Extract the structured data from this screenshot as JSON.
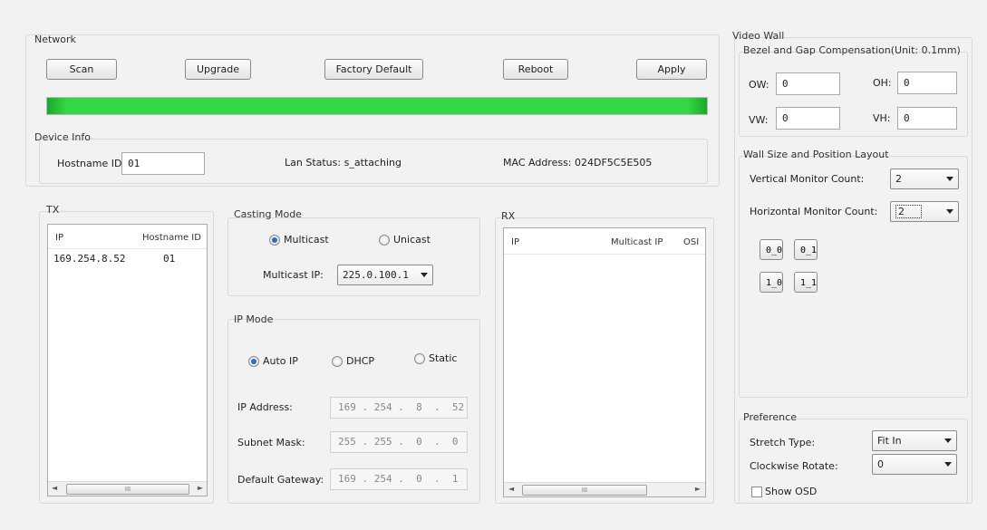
{
  "network": {
    "title": "Network",
    "buttons": {
      "scan": "Scan",
      "upgrade": "Upgrade",
      "factory_default": "Factory Default",
      "reboot": "Reboot",
      "apply": "Apply"
    },
    "progress_fraction": 1.0,
    "progress_color": "#2fcc3d"
  },
  "device_info": {
    "title": "Device Info",
    "hostname_label": "Hostname ID:",
    "hostname_value": "01",
    "lan_status": "Lan Status: s_attaching",
    "mac_address": "MAC Address: 024DF5C5E505"
  },
  "tx": {
    "title": "TX",
    "columns": [
      "IP",
      "Hostname ID"
    ],
    "rows": [
      {
        "ip": "169.254.8.52",
        "hostname": "01"
      }
    ]
  },
  "casting_mode": {
    "title": "Casting Mode",
    "multicast_label": "Multicast",
    "unicast_label": "Unicast",
    "selected": "Multicast",
    "multicast_ip_label": "Multicast IP:",
    "multicast_ip_value": "225.0.100.1"
  },
  "ip_mode": {
    "title": "IP Mode",
    "auto_label": "Auto IP",
    "dhcp_label": "DHCP",
    "static_label": "Static",
    "selected": "Auto IP",
    "ip_address_label": "IP Address:",
    "ip_address_value": "169 . 254 .  8  .  52",
    "subnet_label": "Subnet Mask:",
    "subnet_value": "255 . 255 .  0  .  0",
    "gateway_label": "Default Gateway:",
    "gateway_value": "169 . 254 .  0  .  1"
  },
  "rx": {
    "title": "RX",
    "columns": [
      "IP",
      "Multicast IP",
      "OSI"
    ],
    "rows": []
  },
  "video_wall": {
    "title": "Video Wall",
    "bezel_title": "Bezel and Gap Compensation(Unit: 0.1mm)",
    "ow_label": "OW:",
    "ow_value": "0",
    "oh_label": "OH:",
    "oh_value": "0",
    "vw_label": "VW:",
    "vw_value": "0",
    "vh_label": "VH:",
    "vh_value": "0",
    "layout_title": "Wall Size and Position Layout",
    "vertical_label": "Vertical Monitor Count:",
    "vertical_value": "2",
    "horizontal_label": "Horizontal Monitor Count:",
    "horizontal_value": "2",
    "cells": [
      "0_0",
      "0_1",
      "1_0",
      "1_1"
    ]
  },
  "preference": {
    "title": "Preference",
    "stretch_label": "Stretch Type:",
    "stretch_value": "Fit In",
    "rotate_label": "Clockwise Rotate:",
    "rotate_value": "0",
    "show_osd_label": "Show OSD",
    "show_osd_checked": false
  },
  "icons": {
    "scroll_grip": "III",
    "arrow_left": "◄",
    "arrow_right": "►"
  }
}
